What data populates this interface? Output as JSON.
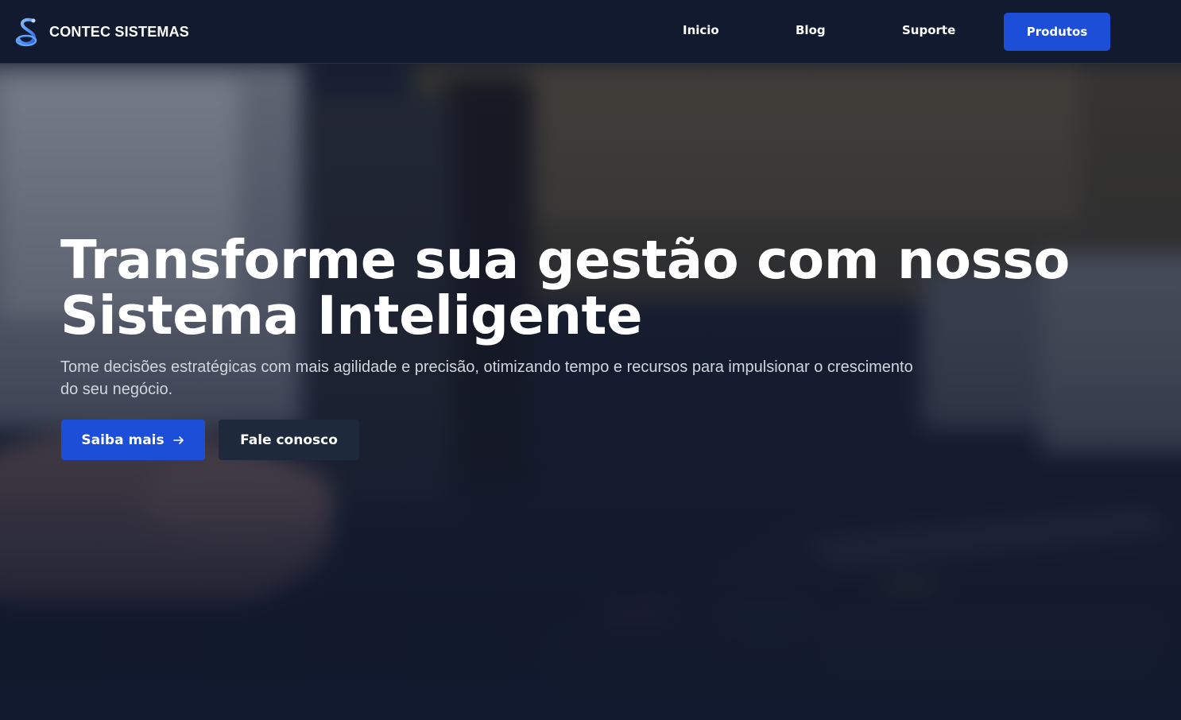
{
  "brand": {
    "name": "CONTEC SISTEMAS",
    "logo_icon": "stylized-s-logo-icon"
  },
  "nav": {
    "links": [
      {
        "label": "Inicio"
      },
      {
        "label": "Blog"
      },
      {
        "label": "Suporte"
      }
    ],
    "cta_label": "Produtos"
  },
  "hero": {
    "title_line1": "Transforme sua gestão com nosso",
    "title_line2": "Sistema Inteligente",
    "subtitle": "Tome decisões estratégicas com mais agilidade e precisão, otimizando tempo e recursos para impulsionar o crescimento do seu negócio.",
    "primary_button": "Saiba mais",
    "primary_button_icon": "arrow-right-icon",
    "secondary_button": "Fale conosco",
    "background_image": "blurred-payment-card-terminal-photo"
  },
  "colors": {
    "navbar_bg": "#111a2e",
    "accent_blue": "#1d4ed8",
    "secondary_button_bg": "#1e293b",
    "text_white": "#ffffff",
    "text_muted": "#d1d5db"
  }
}
